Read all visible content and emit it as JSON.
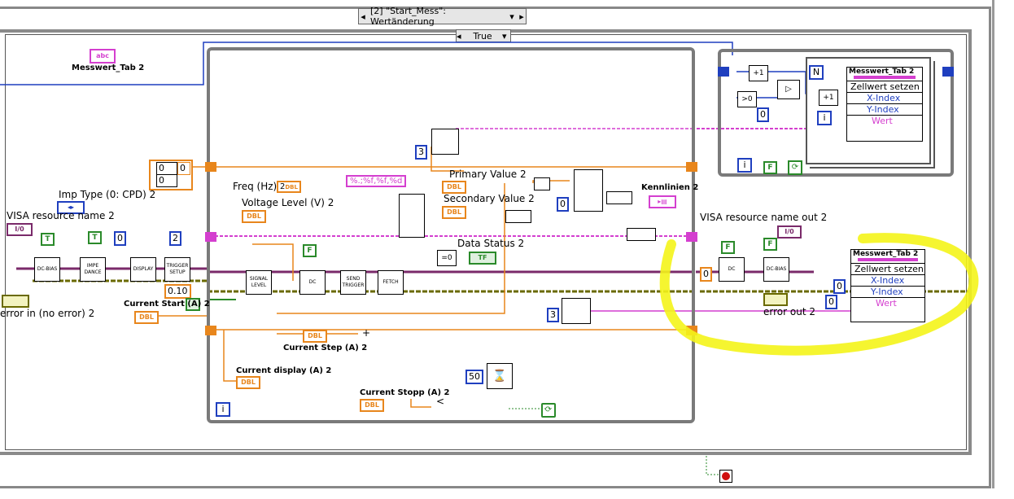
{
  "case_selector": {
    "label": "[2] \"Start_Mess\": Wertänderung"
  },
  "true_selector": {
    "label": "True"
  },
  "labels": {
    "messwert_tab_top": "Messwert_Tab 2",
    "imp_type": "Imp Type (0: CPD) 2",
    "visa_resource": "VISA resource name 2",
    "error_in": "error in (no error) 2",
    "current_start": "Current Start (A) 2",
    "freq": "Freq (Hz)",
    "voltage_level": "Voltage Level (V)  2",
    "primary_value": "Primary Value 2",
    "secondary_value": "Secondary Value 2",
    "data_status": "Data Status 2",
    "kennlinien": "Kennlinien 2",
    "current_step": "Current Step (A) 2",
    "current_display": "Current display (A)  2",
    "current_stopp": "Current Stopp (A) 2",
    "visa_out": "VISA resource name out 2",
    "error_out": "error out 2",
    "format_string": "%.;%f,%f,%d"
  },
  "blocks": {
    "dc_bias1": "DC-BIAS",
    "impedance": "IMPE DANCE",
    "display": "DISPLAY",
    "trigger_setup": "TRIGGER SETUP",
    "signal_level": "SIGNAL LEVEL",
    "dc": "DC",
    "send_trigger": "SEND TRIGGER",
    "fetch": "FETCH",
    "dc2": "DC",
    "dc_bias2": "DC-BIAS"
  },
  "constants": {
    "zero_a": "0",
    "zero_b": "0",
    "zero_c": "0",
    "num_2": "2",
    "num_0_10": "0.10",
    "num_3a": "3",
    "num_3b": "3",
    "num_0_mid": "0",
    "num_50": "50",
    "freq_2": "2",
    "num_0_right": "0",
    "num_0_r1": "0",
    "num_0_r2": "0",
    "num_0_top": "0",
    "t1": "T",
    "t2": "T",
    "f1": "F",
    "f2": "F",
    "f3": "F",
    "f4": "F",
    "tf": "TF",
    "dbl": "DBL",
    "abc": "abc",
    "io": "I/0",
    "i_index": "i",
    "n_count": "N"
  },
  "property_node_top": {
    "title": "Messwert_Tab 2",
    "method": "Zellwert setzen",
    "rows": [
      "X-Index",
      "Y-Index",
      "Wert"
    ]
  },
  "property_node_bottom": {
    "title": "Messwert_Tab 2",
    "method": "Zellwert setzen",
    "rows": [
      "X-Index",
      "Y-Index",
      "Wert"
    ]
  },
  "colors": {
    "case_border": "#7f7f7f",
    "loop_border": "#777777",
    "wire_orange": "#e8861c",
    "wire_pink": "#d43fcf",
    "wire_blue": "#1f3fbf",
    "wire_yellow_cluster": "#b8a400",
    "highlight": "#f4f41a",
    "green_const": "#2a8a2a"
  }
}
